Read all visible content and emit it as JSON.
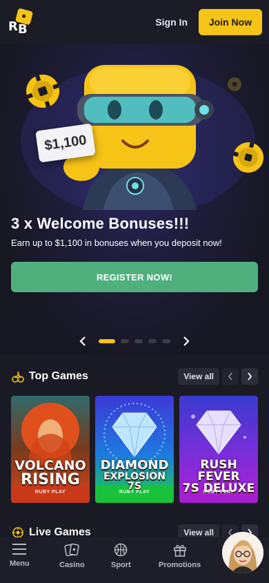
{
  "header": {
    "sign_in": "Sign In",
    "join_now": "Join Now",
    "logo_letters": [
      "R",
      "B"
    ]
  },
  "hero": {
    "badge": "$1,100",
    "title": "3 x Welcome Bonuses!!!",
    "subtitle": "Earn up to $1,100 in bonuses when you deposit now!",
    "cta": "REGISTER NOW!",
    "carousel": {
      "active_index": 0,
      "total": 5
    }
  },
  "sections": {
    "top_games": {
      "title": "Top Games",
      "view_all": "View all"
    },
    "live_games": {
      "title": "Live Games",
      "view_all": "View all"
    }
  },
  "games": [
    {
      "title_line1": "VOLCANO",
      "title_line2": "RISING",
      "provider": "RUBY PLAY"
    },
    {
      "title_line1": "DIAMOND",
      "title_line2": "EXPLOSION 7S",
      "provider": "RUBY PLAY"
    },
    {
      "title_line1": "RUSH FEVER",
      "title_line2": "7S DELUXE",
      "provider": "RUBY PLAY"
    }
  ],
  "bottom_nav": [
    {
      "label": "Menu",
      "icon": "menu-icon"
    },
    {
      "label": "Casino",
      "icon": "cards-icon"
    },
    {
      "label": "Sport",
      "icon": "basketball-icon"
    },
    {
      "label": "Promotions",
      "icon": "gift-icon"
    }
  ],
  "colors": {
    "accent": "#f6c416",
    "cta_green": "#4fb07e",
    "background": "#1a1a24"
  }
}
